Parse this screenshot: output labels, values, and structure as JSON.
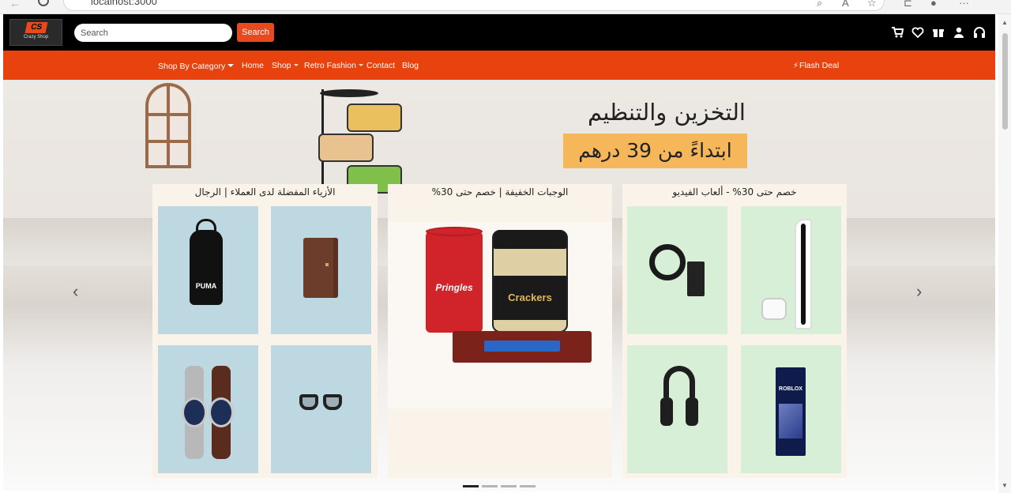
{
  "browser": {
    "url": "localhost:3000"
  },
  "header": {
    "logo_text": "Crazy Shop",
    "logo_mark": "CS",
    "search_placeholder": "Search",
    "search_button": "Search",
    "icons": [
      "cart-icon",
      "heart-icon",
      "gift-icon",
      "user-icon",
      "headphones-icon"
    ]
  },
  "nav": {
    "shop_by_category": "Shop By Category",
    "home": "Home",
    "shop": "Shop",
    "retro_fashion": "Retro Fashion",
    "contact": "Contact",
    "blog": "Blog",
    "flash_deal": "Flash Deal"
  },
  "hero": {
    "title": "التخزين والتنظيم",
    "price_banner": "ابتداءً من 39 درهم",
    "prev_arrow": "‹",
    "next_arrow": "›",
    "slide_count": 4,
    "active_slide": 0
  },
  "cards": [
    {
      "title": "الأزياء المفضلة لدى العملاء | الرجال"
    },
    {
      "title": "الوجبات الخفيفة | خصم حتى 30%"
    },
    {
      "title": "خصم حتى 30% - ألعاب الفيديو"
    }
  ],
  "products": {
    "backpack_brand": "PUMA",
    "pringles_brand": "Pringles",
    "crackers_brand": "Crackers",
    "game_card_brand": "ROBLOX"
  },
  "colors": {
    "brand_orange": "#e8430e",
    "header_black": "#000000",
    "hero_price_bg": "#f5b759"
  }
}
